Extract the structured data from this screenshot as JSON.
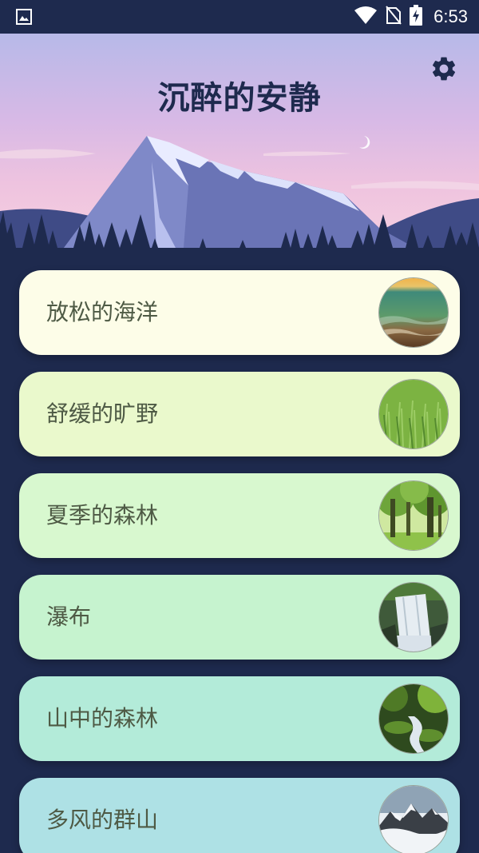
{
  "status_bar": {
    "time": "6:53",
    "icons": [
      "gallery-icon",
      "wifi-icon",
      "no-sim-icon",
      "battery-charging-icon"
    ]
  },
  "header": {
    "title": "沉醉的安静",
    "settings_icon": "gear-icon"
  },
  "sounds": [
    {
      "label": "放松的海洋",
      "card_color": "#fdfde8",
      "thumb": "ocean"
    },
    {
      "label": "舒缓的旷野",
      "card_color": "#eaf9cc",
      "thumb": "grass"
    },
    {
      "label": "夏季的森林",
      "card_color": "#d8f8cf",
      "thumb": "forest"
    },
    {
      "label": "瀑布",
      "card_color": "#c6f3cf",
      "thumb": "waterfall"
    },
    {
      "label": "山中的森林",
      "card_color": "#b3ebd9",
      "thumb": "mountain-stream"
    },
    {
      "label": "多风的群山",
      "card_color": "#aee1e5",
      "thumb": "mountains"
    }
  ]
}
